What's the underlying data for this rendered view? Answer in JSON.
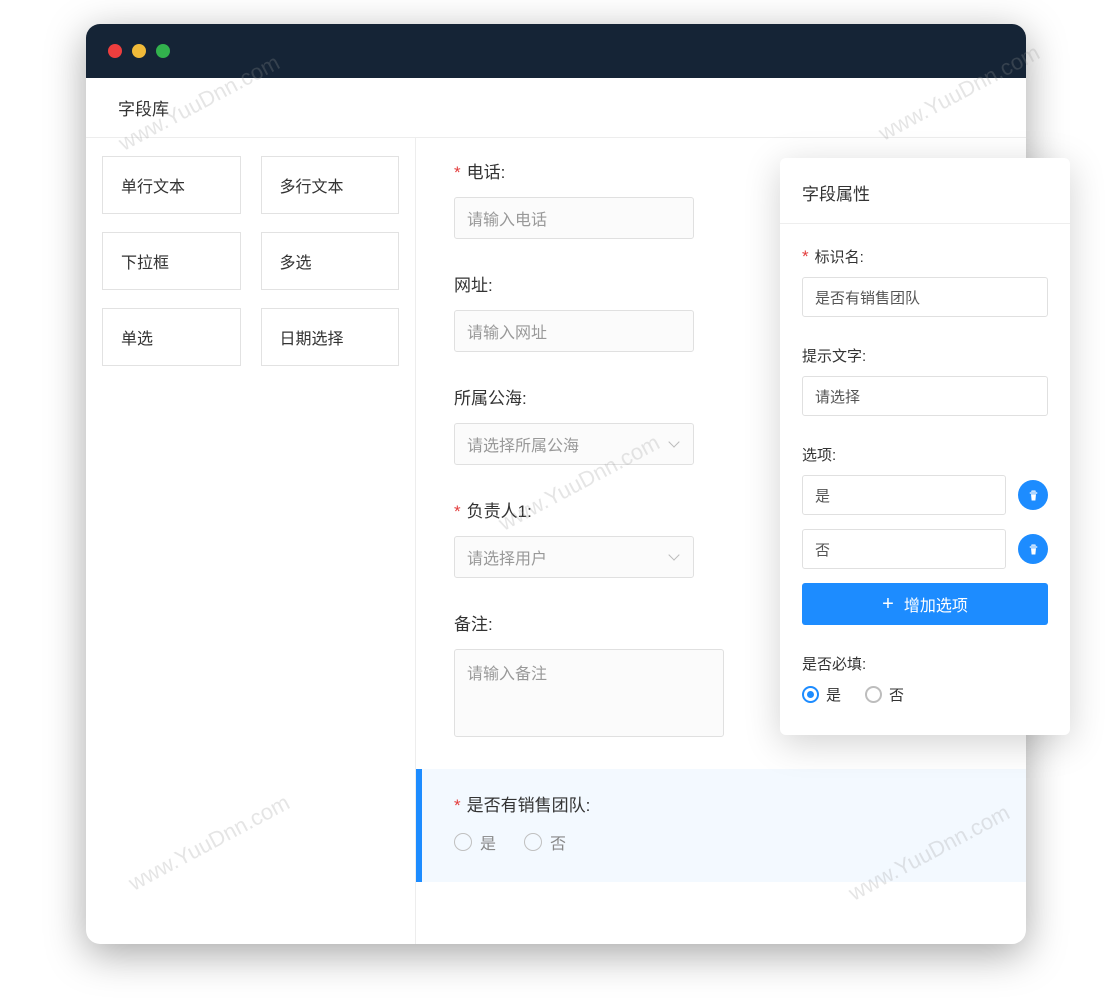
{
  "watermark": "www.YuuDnn.com",
  "header": {
    "title": "字段库"
  },
  "field_library": [
    {
      "label": "单行文本"
    },
    {
      "label": "多行文本"
    },
    {
      "label": "下拉框"
    },
    {
      "label": "多选"
    },
    {
      "label": "单选"
    },
    {
      "label": "日期选择"
    }
  ],
  "form": {
    "phone": {
      "label": "电话:",
      "placeholder": "请输入电话",
      "required": true
    },
    "url": {
      "label": "网址:",
      "placeholder": "请输入网址",
      "required": false
    },
    "sea": {
      "label": "所属公海:",
      "placeholder": "请选择所属公海",
      "required": false
    },
    "owner": {
      "label": "负责人1:",
      "placeholder": "请选择用户",
      "required": true
    },
    "remark": {
      "label": "备注:",
      "placeholder": "请输入备注",
      "required": false
    },
    "selected": {
      "label": "是否有销售团队:",
      "required": true,
      "options": [
        "是",
        "否"
      ]
    }
  },
  "props": {
    "title": "字段属性",
    "id_label": "标识名:",
    "id_value": "是否有销售团队",
    "hint_label": "提示文字:",
    "hint_value": "请选择",
    "options_label": "选项:",
    "options": [
      "是",
      "否"
    ],
    "add_option_label": "增加选项",
    "required_label": "是否必填:",
    "required_yes": "是",
    "required_no": "否",
    "required_value": "是"
  }
}
